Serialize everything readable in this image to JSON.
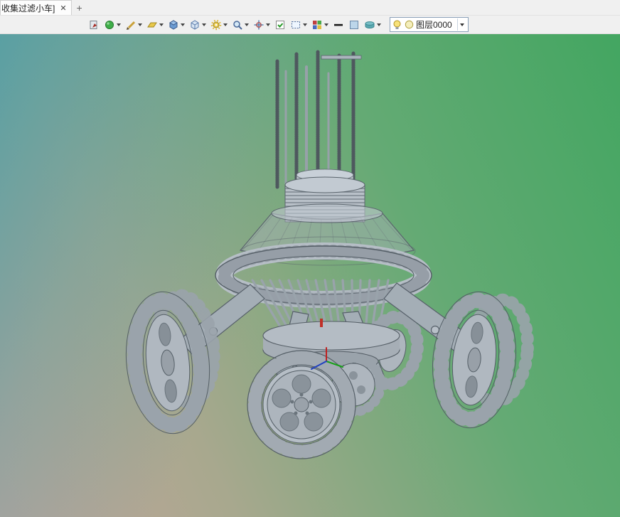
{
  "tab_bar": {
    "active_tab": {
      "label": "收集过滤小车]",
      "close_glyph": "✕"
    },
    "new_tab_glyph": "+"
  },
  "toolbar": {
    "icons": [
      {
        "name": "export-view-icon"
      },
      {
        "name": "render-material-icon"
      },
      {
        "name": "sketch-pencil-icon"
      },
      {
        "name": "datum-plane-icon"
      },
      {
        "name": "solid-display-icon"
      },
      {
        "name": "wireframe-display-icon"
      },
      {
        "name": "gear-tool-icon"
      },
      {
        "name": "zoom-icon"
      },
      {
        "name": "view-orientation-icon"
      },
      {
        "name": "select-filter-icon"
      },
      {
        "name": "window-select-icon"
      },
      {
        "name": "color-palette-icon"
      },
      {
        "name": "line-width-icon"
      },
      {
        "name": "color-swatch-icon"
      },
      {
        "name": "surface-style-icon"
      }
    ],
    "layer_combo": {
      "label": "图层0000",
      "bulb_icon": "layer-visibility-bulb",
      "layer_color_dot": "#f4eebc"
    }
  },
  "viewport": {
    "background_colors": {
      "top_left": "#4aa0a6",
      "top_right": "#3ca466",
      "bottom_left": "#c3a59b",
      "bottom_right": "#43a661"
    },
    "model": {
      "description": "omni-wheel filter cart 3D model",
      "body_color": "#b4bcc4",
      "outline_color": "#59636b",
      "origin_triad": {
        "x_color": "#c02020",
        "y_color": "#18a018",
        "z_color": "#2040c0"
      },
      "marker_color": "#c03028"
    }
  }
}
